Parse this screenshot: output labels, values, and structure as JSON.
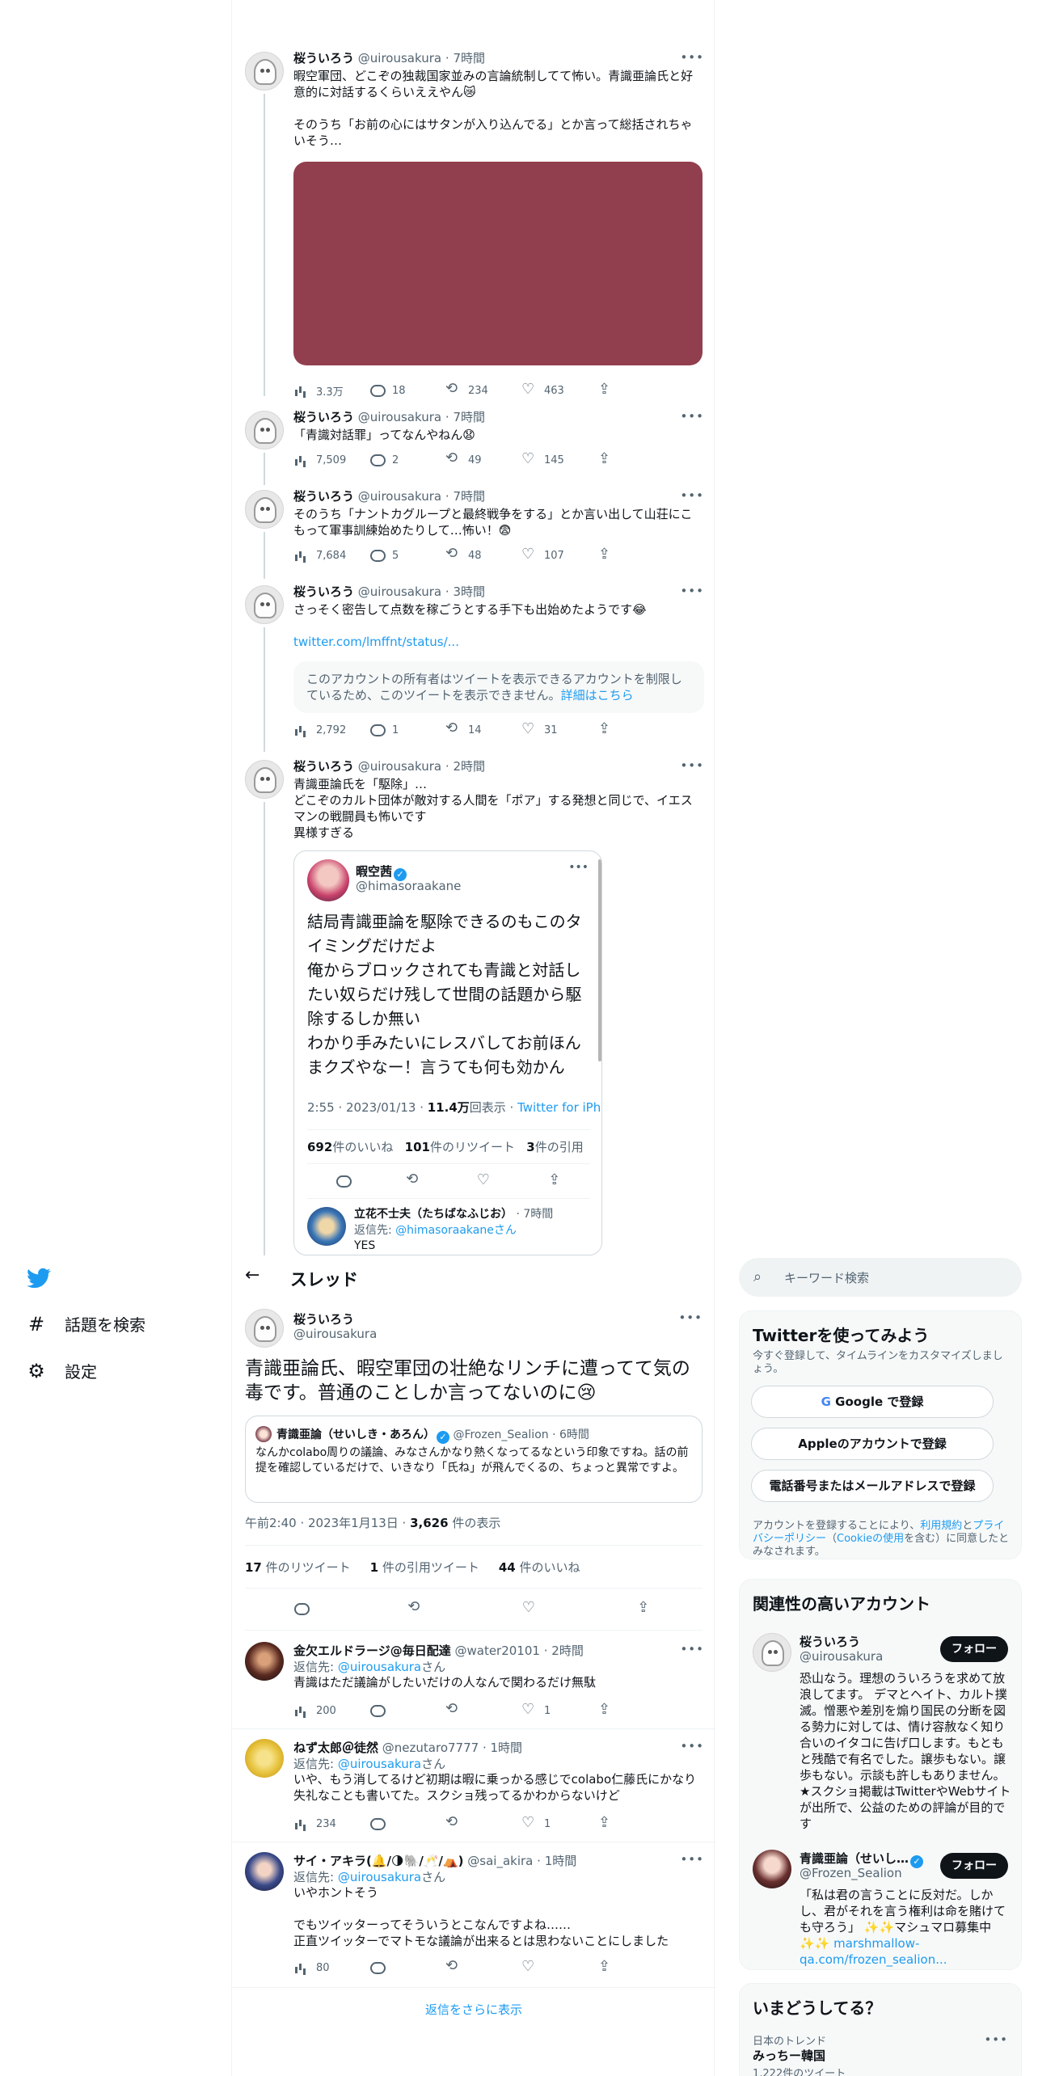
{
  "colors": {
    "accent": "#1d9bf0",
    "text": "#0f1419",
    "muted": "#536471",
    "media": "#913f4e"
  },
  "thread_top": [
    {
      "name": "桜ういろう",
      "handle": "@uirousakura",
      "time": "7時間",
      "text": "暇空軍団、どこぞの独裁国家並みの言論統制してて怖い。青識亜論氏と好意的に対話するくらいええやん😿\n\nそのうち「お前の心にはサタンが入り込んでる」とか言って総括されちゃいそう…",
      "views": "3.3万",
      "replies": "18",
      "retweets": "234",
      "likes": "463"
    },
    {
      "name": "桜ういろう",
      "handle": "@uirousakura",
      "time": "7時間",
      "text": "「青識対話罪」ってなんやねん😧",
      "views": "7,509",
      "replies": "2",
      "retweets": "49",
      "likes": "145"
    },
    {
      "name": "桜ういろう",
      "handle": "@uirousakura",
      "time": "7時間",
      "text": "そのうち「ナントカグループと最終戦争をする」とか言い出して山荘にこもって軍事訓練始めたりして…怖い！😨",
      "views": "7,684",
      "replies": "5",
      "retweets": "48",
      "likes": "107"
    },
    {
      "name": "桜ういろう",
      "handle": "@uirousakura",
      "time": "3時間",
      "text": "さっそく密告して点数を稼ごうとする手下も出始めたようです😂",
      "link": "twitter.com/lmffnt/status/...",
      "notice": "このアカウントの所有者はツイートを表示できるアカウントを制限しているため、このツイートを表示できません。",
      "notice_link": "詳細はこちら",
      "views": "2,792",
      "replies": "1",
      "retweets": "14",
      "likes": "31"
    },
    {
      "name": "桜ういろう",
      "handle": "@uirousakura",
      "time": "2時間",
      "text": "青識亜論氏を「駆除」…\nどこぞのカルト団体が敵対する人間を「ポア」する発想と同じで、イエスマンの戦闘員も怖いです\n異様すぎる"
    }
  ],
  "quote_card": {
    "name": "暇空茜",
    "handle": "@himasoraakane",
    "text": "結局青識亜論を駆除できるのもこのタイミングだけだよ\n俺からブロックされても青識と対話したい奴らだけ残して世間の話題から駆除するしか無い\nわかり手みたいにレスバしてお前ほんまクズやなー！言うても何も効かん",
    "meta_time": "2:55 · 2023/01/13 · ",
    "meta_views": "11.4万",
    "meta_views_label": "回表示 · ",
    "meta_source": "Twitter for iPhone",
    "likes": "692",
    "likes_label": "件のいいね",
    "retweets": "101",
    "retweets_label": "件のリツイート",
    "quotes": "3",
    "quotes_label": "件の引用",
    "reply_name": "立花不士夫（たちばなふじお）",
    "reply_time": "· 7時間",
    "reply_to_label": "返信先: ",
    "reply_to": "@himasoraakane",
    "reply_to_suffix": "さん",
    "reply_text": "YES"
  },
  "sidebar": {
    "explore_label": "話題を検索",
    "settings_label": "設定"
  },
  "main": {
    "header_title": "スレッド",
    "tweet": {
      "name": "桜ういろう",
      "handle": "@uirousakura",
      "text": "青識亜論氏、暇空軍団の壮絶なリンチに遭ってて気の毒です。普通のことしか言ってないのに😢",
      "embed_name": "青識亜論（せいしき・あろん）",
      "embed_handle": "@Frozen_Sealion",
      "embed_time": "· 6時間",
      "embed_text": "なんかcolabo周りの議論、みなさんかなり熱くなってるなという印象ですね。話の前提を確認しているだけで、いきなり「氏ね」が飛んでくるの、ちょっと異常ですよ。",
      "meta": "午前2:40 · 2023年1月13日 · ",
      "views": "3,626",
      "views_label": " 件の表示",
      "retweets": "17",
      "retweets_label": " 件のリツイート",
      "quotes": "1",
      "quotes_label": " 件の引用ツイート",
      "likes": "44",
      "likes_label": " 件のいいね"
    },
    "replies": [
      {
        "name": "金欠エルドラージ@毎日配達",
        "handle": "@water20101",
        "time": "· 2時間",
        "reply_to_label": "返信先: ",
        "reply_to": "@uirousakura",
        "reply_to_suffix": "さん",
        "text": "青識はただ議論がしたいだけの人なんで関わるだけ無駄",
        "views": "200",
        "replies": "",
        "retweets": "",
        "likes": "1"
      },
      {
        "name": "ねず太郎＠徒然",
        "handle": "@nezutaro7777",
        "time": "· 1時間",
        "reply_to_label": "返信先: ",
        "reply_to": "@uirousakura",
        "reply_to_suffix": "さん",
        "text": "いや、もう消してるけど初期は暇に乗っかる感じでcolabo仁藤氏にかなり失礼なことも書いてた。スクショ残ってるかわからないけど",
        "views": "234",
        "replies": "",
        "retweets": "",
        "likes": "1"
      },
      {
        "name": "サイ・アキラ(🔔/🌗🐘/🥂/⛺)",
        "handle": "@sai_akira",
        "time": "· 1時間",
        "reply_to_label": "返信先: ",
        "reply_to": "@uirousakura",
        "reply_to_suffix": "さん",
        "text": "いやホントそう\n\nでもツイッターってそういうとこなんですよね……\n正直ツイッターでマトモな議論が出来るとは思わないことにしました",
        "views": "80",
        "replies": "",
        "retweets": "",
        "likes": ""
      }
    ],
    "show_more": "返信をさらに表示"
  },
  "right": {
    "search_placeholder": "キーワード検索",
    "signup": {
      "title": "Twitterを使ってみよう",
      "desc": "今すぐ登録して、タイムラインをカスタマイズしましょう。",
      "google": "Google で登録",
      "apple": "Appleのアカウントで登録",
      "phone": "電話番号またはメールアドレスで登録",
      "terms_1": "アカウントを登録することにより、",
      "terms_link1": "利用規約",
      "terms_2": "と",
      "terms_link2": "プライバシーポリシー",
      "terms_3": "（",
      "terms_link3": "Cookieの使用",
      "terms_4": "を含む）に同意したとみなされます。"
    },
    "related": {
      "title": "関連性の高いアカウント",
      "accounts": [
        {
          "name": "桜ういろう",
          "handle": "@uirousakura",
          "follow": "フォロー",
          "bio": "恐山なう。理想のういろうを求めて放浪してます。 デマとヘイト、カルト撲滅。憎悪や差別を煽り国民の分断を図る勢力に対しては、情け容赦なく知り合いのイタコに告げ口します。もともと残酷で有名でした。譲歩もない。譲歩もない。示談も許しもありません。★スクショ掲載はTwitterやWebサイトが出所で、公益のための評論が目的です"
        },
        {
          "name": "青識亜論（せいし…",
          "handle": "@Frozen_Sealion",
          "follow": "フォロー",
          "bio": "「私は君の言うことに反対だ。しかし、君がそれを言う権利は命を賭けても守ろう」",
          "bio_2": " ✨✨マシュマロ募集中✨✨ ",
          "bio_link": "marshmallow-qa.com/frozen_sealion..."
        }
      ]
    },
    "trends": {
      "title": "いまどうしてる？",
      "context": "日本のトレンド",
      "name": "みっちー韓国",
      "count": "1,222件のツイート"
    }
  }
}
